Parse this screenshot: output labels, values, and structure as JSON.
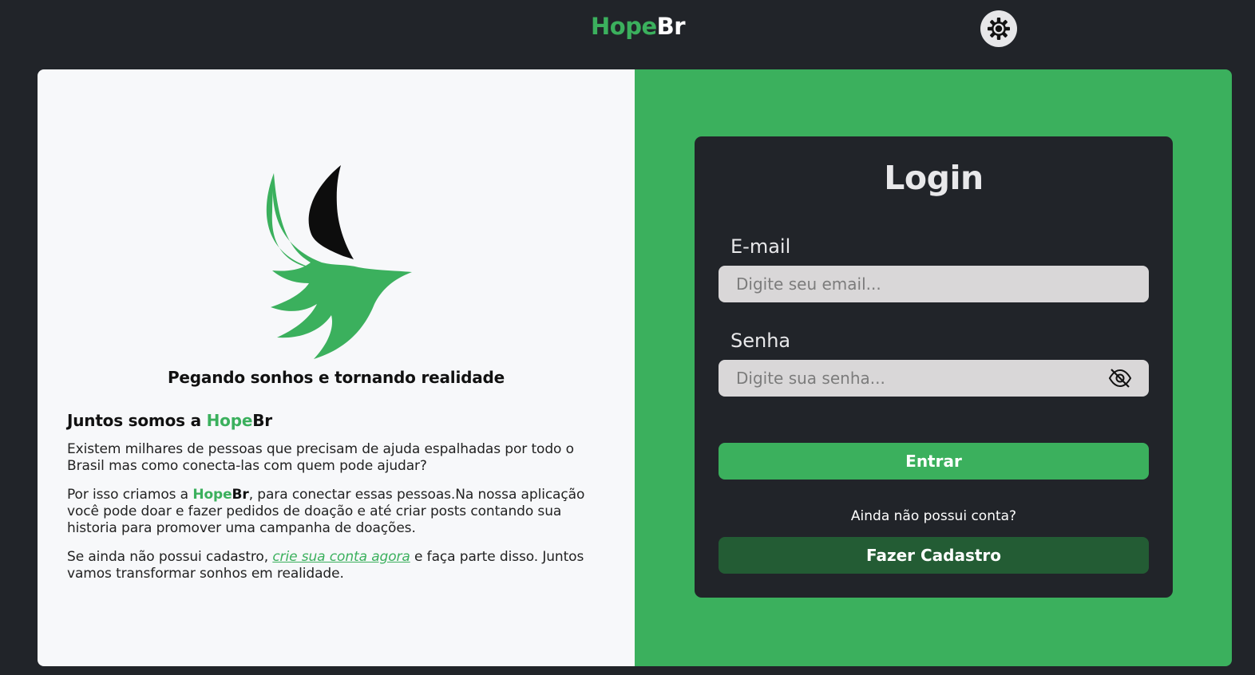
{
  "header": {
    "brand_part1": "Hope",
    "brand_part2": "Br",
    "theme_toggle_icon": "sun-gear-icon"
  },
  "hero": {
    "logo_icon": "bird-logo-icon",
    "tagline": "Pegando sonhos e tornando realidade"
  },
  "about": {
    "heading_prefix": "Juntos somos a ",
    "heading_hope": "Hope",
    "heading_br": "Br",
    "p1": "Existem milhares de pessoas que precisam de ajuda espalhadas por todo o Brasil mas como conecta-las com quem pode ajudar?",
    "p2_prefix": "Por isso criamos a ",
    "p2_hope": "Hope",
    "p2_br": "Br",
    "p2_suffix": ", para conectar essas pessoas.Na nossa aplicação você pode doar e fazer pedidos de doação e até criar posts contando sua historia para promover uma campanha de doações.",
    "p3_prefix": "Se ainda não possui cadastro, ",
    "p3_link": "crie sua conta agora",
    "p3_suffix": " e faça parte disso. Juntos vamos transformar sonhos em realidade."
  },
  "login": {
    "title": "Login",
    "email_label": "E-mail",
    "email_placeholder": "Digite seu email...",
    "email_value": "",
    "password_label": "Senha",
    "password_placeholder": "Digite sua senha...",
    "password_value": "",
    "password_toggle_icon": "eye-slash-icon",
    "submit_label": "Entrar",
    "no_account_text": "Ainda não possui conta?",
    "signup_label": "Fazer Cadastro"
  },
  "colors": {
    "background": "#212429",
    "accent": "#3bb05d",
    "accent_dark": "#235c34",
    "panel_light": "#f7f8fa",
    "input_bg": "#d9d7d8"
  }
}
